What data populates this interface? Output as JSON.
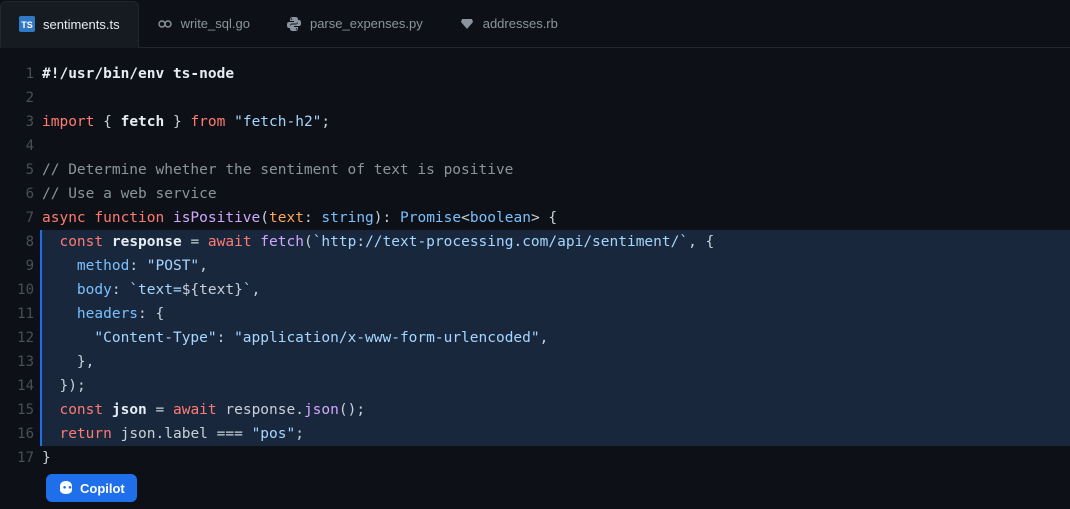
{
  "tabs": {
    "items": [
      {
        "label": "sentiments.ts",
        "icon": "typescript-icon",
        "active": true
      },
      {
        "label": "write_sql.go",
        "icon": "go-icon",
        "active": false
      },
      {
        "label": "parse_expenses.py",
        "icon": "python-icon",
        "active": false
      },
      {
        "label": "addresses.rb",
        "icon": "ruby-icon",
        "active": false
      }
    ]
  },
  "editor": {
    "active_file": "sentiments.ts",
    "line_count": 17,
    "highlighted_lines": [
      8,
      9,
      10,
      11,
      12,
      13,
      14,
      15,
      16
    ],
    "code": {
      "l1": {
        "shebang": "#!/usr/bin/env ts-node"
      },
      "l2": {
        "blank": ""
      },
      "l3": {
        "kw_import": "import",
        "brace_open": "{",
        "ident_fetch": "fetch",
        "brace_close": "}",
        "kw_from": "from",
        "str_fetchh2": "\"fetch-h2\"",
        "semi": ";"
      },
      "l4": {
        "blank": ""
      },
      "l5": {
        "comment": "// Determine whether the sentiment of text is positive"
      },
      "l6": {
        "comment": "// Use a web service"
      },
      "l7": {
        "kw_async": "async",
        "kw_function": "function",
        "fn_name": "isPositive",
        "lparen": "(",
        "param_text": "text",
        "colon1": ":",
        "type_string": "string",
        "rparen": ")",
        "colon2": ":",
        "type_promise": "Promise",
        "lt": "<",
        "type_boolean": "boolean",
        "gt": ">",
        "lbrace": "{"
      },
      "l8": {
        "kw_const": "const",
        "ident_response": "response",
        "eq": "=",
        "kw_await": "await",
        "fn_fetch": "fetch",
        "lparen": "(",
        "tpl_open": "`",
        "url": "http://text-processing.com/api/sentiment/",
        "tpl_close": "`",
        "comma": ",",
        "lbrace": "{"
      },
      "l9": {
        "prop_method": "method",
        "colon": ":",
        "str_post": "\"POST\"",
        "comma": ","
      },
      "l10": {
        "prop_body": "body",
        "colon": ":",
        "tpl_open": "`",
        "tpl_text_pre": "text=",
        "interp_open": "${",
        "ident_text": "text",
        "interp_close": "}",
        "tpl_close": "`",
        "comma": ","
      },
      "l11": {
        "prop_headers": "headers",
        "colon": ":",
        "lbrace": "{"
      },
      "l12": {
        "str_ct_key": "\"Content-Type\"",
        "colon": ":",
        "str_ct_val": "\"application/x-www-form-urlencoded\"",
        "comma": ","
      },
      "l13": {
        "rbrace": "}",
        "comma": ","
      },
      "l14": {
        "rbrace": "}",
        "rparen": ")",
        "semi": ";"
      },
      "l15": {
        "kw_const": "const",
        "ident_json": "json",
        "eq": "=",
        "kw_await": "await",
        "ident_response": "response",
        "dot": ".",
        "fn_json": "json",
        "lparen": "(",
        "rparen": ")",
        "semi": ";"
      },
      "l16": {
        "kw_return": "return",
        "ident_json": "json",
        "dot": ".",
        "prop_label": "label",
        "eqeqeq": "===",
        "str_pos": "\"pos\"",
        "semi": ";"
      },
      "l17": {
        "rbrace": "}"
      }
    }
  },
  "copilot": {
    "label": "Copilot"
  },
  "colors": {
    "background": "#0d1117",
    "accent": "#1f6feb",
    "keyword": "#ff7b72",
    "string": "#a5d6ff",
    "comment": "#8b949e",
    "function": "#d2a8ff",
    "type": "#79c0ff"
  }
}
